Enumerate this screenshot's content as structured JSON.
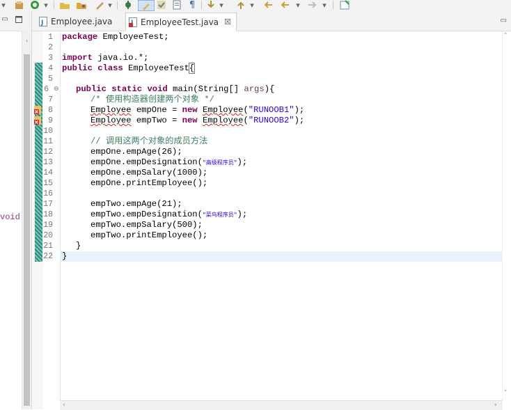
{
  "toolbar": {
    "icons": [
      "new-class-icon",
      "refresh-icon",
      "dropdown-icon",
      "open-folder-icon",
      "open-type-icon",
      "annotation-icon",
      "dropdown-icon",
      "debug-icon",
      "highlight-icon",
      "toggle-mark-icon",
      "block-select-icon",
      "pilcrow-icon",
      "next-annotation-icon",
      "dropdown-icon",
      "back-icon",
      "dropdown-icon",
      "forward-icon",
      "dropdown-icon",
      "pin-editor-icon"
    ]
  },
  "left_panel": {
    "visible_text": "void"
  },
  "tabs": [
    {
      "label": "Employee.java",
      "active": false,
      "icon": "java-file-icon"
    },
    {
      "label": "EmployeeTest.java",
      "active": true,
      "icon": "java-file-error-icon",
      "close": "☒"
    }
  ],
  "editor": {
    "line_numbers": [
      "1",
      "2",
      "3",
      "4",
      "5",
      "6",
      "7",
      "8",
      "9",
      "10",
      "11",
      "12",
      "13",
      "14",
      "15",
      "16",
      "17",
      "18",
      "19",
      "20",
      "21",
      "22"
    ],
    "fold_markers": {
      "line": "6",
      "glyph": "⊖"
    },
    "code": {
      "l1": {
        "kw": "package",
        "rest": " EmployeeTest;"
      },
      "l3": {
        "kw": "import",
        "rest": " java.io.*;"
      },
      "l4": {
        "kw1": "public",
        "kw2": "class",
        "rest": " EmployeeTest",
        "brace": "{"
      },
      "l6": {
        "kw1": "public",
        "kw2": "static",
        "kw3": "void",
        "mid": " main(String[] ",
        "param": "args",
        "end": "){"
      },
      "l7": {
        "comment": "/* 使用构造器创建两个对象 */"
      },
      "l8": {
        "t1": "Employee",
        "t2": " empOne = ",
        "kw": "new",
        "t3": " ",
        "t4": "Employee",
        "t5": "(",
        "str": "\"RUNOOB1\"",
        "t6": ");"
      },
      "l9": {
        "t1": "Employee",
        "t2": " empTwo = ",
        "kw": "new",
        "t3": " ",
        "t4": "Employee",
        "t5": "(",
        "str": "\"RUNOOB2\"",
        "t6": ");"
      },
      "l11": {
        "comment": "// 调用这两个对象的成员方法"
      },
      "l12": "empOne.empAge(26);",
      "l13": {
        "pre": "empOne.empDesignation(",
        "str": "\"高级程序员\"",
        "post": ");"
      },
      "l14": "empOne.empSalary(1000);",
      "l15": "empOne.printEmployee();",
      "l17": "empTwo.empAge(21);",
      "l18": {
        "pre": "empTwo.empDesignation(",
        "str": "\"菜鸟程序员\"",
        "post": ");"
      },
      "l19": "empTwo.empSalary(500);",
      "l20": "empTwo.printEmployee();",
      "l21": "}",
      "l22": "}"
    }
  },
  "colors": {
    "keyword": "#7f0055",
    "comment": "#3f7f5f",
    "string": "#2a00ff",
    "current_line": "#e8f2fe"
  }
}
